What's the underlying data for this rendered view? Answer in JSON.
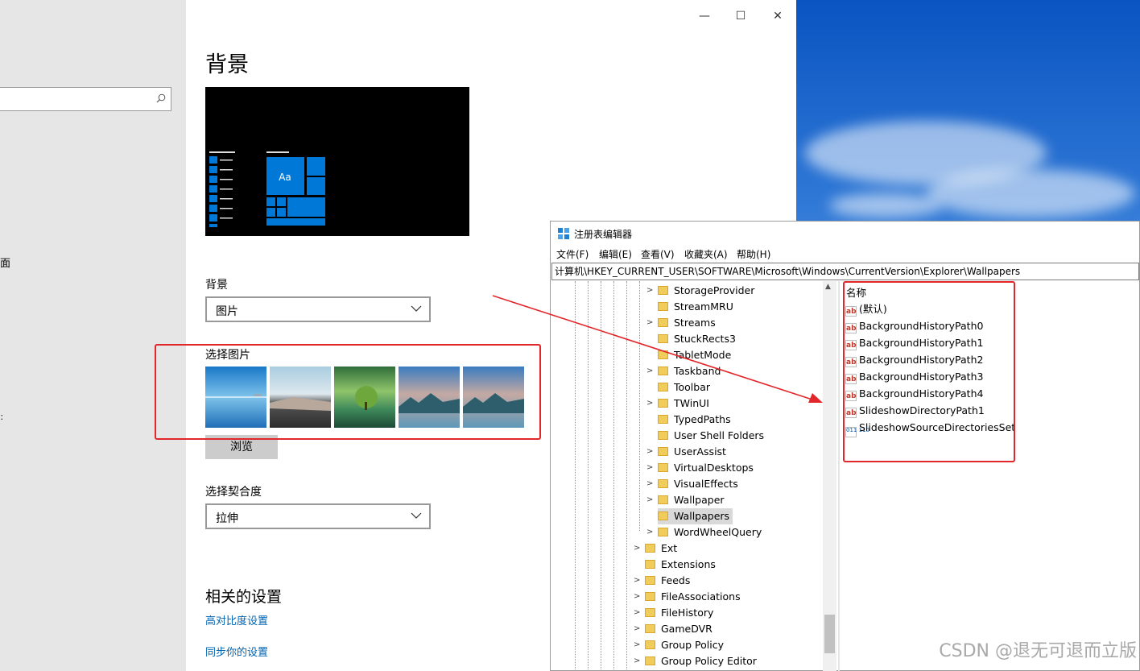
{
  "settings": {
    "page_title": "背景",
    "left_frag_1": "面",
    "left_frag_2": "：",
    "background_label": "背景",
    "background_value": "图片",
    "choose_picture_label": "选择图片",
    "browse_label": "浏览",
    "fit_label": "选择契合度",
    "fit_value": "拉伸",
    "related_title": "相关的设置",
    "links": [
      "高对比度设置",
      "同步你的设置"
    ],
    "preview_tile_text": "Aa",
    "window_controls": {
      "minimize": "—",
      "maximize": "☐",
      "close": "✕"
    }
  },
  "regedit": {
    "title": "注册表编辑器",
    "menu": [
      "文件(F)",
      "编辑(E)",
      "查看(V)",
      "收藏夹(A)",
      "帮助(H)"
    ],
    "address": "计算机\\HKEY_CURRENT_USER\\SOFTWARE\\Microsoft\\Windows\\CurrentVersion\\Explorer\\Wallpapers",
    "tree_items": [
      {
        "label": "StorageProvider",
        "level": 2,
        "expander": true
      },
      {
        "label": "StreamMRU",
        "level": 2,
        "expander": false
      },
      {
        "label": "Streams",
        "level": 2,
        "expander": true
      },
      {
        "label": "StuckRects3",
        "level": 2,
        "expander": false
      },
      {
        "label": "TabletMode",
        "level": 2,
        "expander": false
      },
      {
        "label": "Taskband",
        "level": 2,
        "expander": true
      },
      {
        "label": "Toolbar",
        "level": 2,
        "expander": false
      },
      {
        "label": "TWinUI",
        "level": 2,
        "expander": true
      },
      {
        "label": "TypedPaths",
        "level": 2,
        "expander": false
      },
      {
        "label": "User Shell Folders",
        "level": 2,
        "expander": false
      },
      {
        "label": "UserAssist",
        "level": 2,
        "expander": true
      },
      {
        "label": "VirtualDesktops",
        "level": 2,
        "expander": true
      },
      {
        "label": "VisualEffects",
        "level": 2,
        "expander": true
      },
      {
        "label": "Wallpaper",
        "level": 2,
        "expander": true
      },
      {
        "label": "Wallpapers",
        "level": 2,
        "expander": false,
        "selected": true
      },
      {
        "label": "WordWheelQuery",
        "level": 2,
        "expander": true
      },
      {
        "label": "Ext",
        "level": 1,
        "expander": true
      },
      {
        "label": "Extensions",
        "level": 1,
        "expander": false
      },
      {
        "label": "Feeds",
        "level": 1,
        "expander": true
      },
      {
        "label": "FileAssociations",
        "level": 1,
        "expander": true
      },
      {
        "label": "FileHistory",
        "level": 1,
        "expander": true
      },
      {
        "label": "GameDVR",
        "level": 1,
        "expander": true
      },
      {
        "label": "Group Policy",
        "level": 1,
        "expander": true
      },
      {
        "label": "Group Policy Editor",
        "level": 1,
        "expander": true
      }
    ],
    "values_header": "名称",
    "values": [
      {
        "name": "(默认)",
        "type": "string"
      },
      {
        "name": "BackgroundHistoryPath0",
        "type": "string"
      },
      {
        "name": "BackgroundHistoryPath1",
        "type": "string"
      },
      {
        "name": "BackgroundHistoryPath2",
        "type": "string"
      },
      {
        "name": "BackgroundHistoryPath3",
        "type": "string"
      },
      {
        "name": "BackgroundHistoryPath4",
        "type": "string"
      },
      {
        "name": "SlideshowDirectoryPath1",
        "type": "string"
      },
      {
        "name": "SlideshowSourceDirectoriesSet",
        "type": "binary"
      }
    ],
    "string_icon_text": "ab",
    "binary_icon_text": "011\n110"
  },
  "watermark": "CSDN @退无可退而立版",
  "colors": {
    "annotation_red": "#e3262a",
    "accent_blue": "#0078d7",
    "link_blue": "#0063b1"
  }
}
